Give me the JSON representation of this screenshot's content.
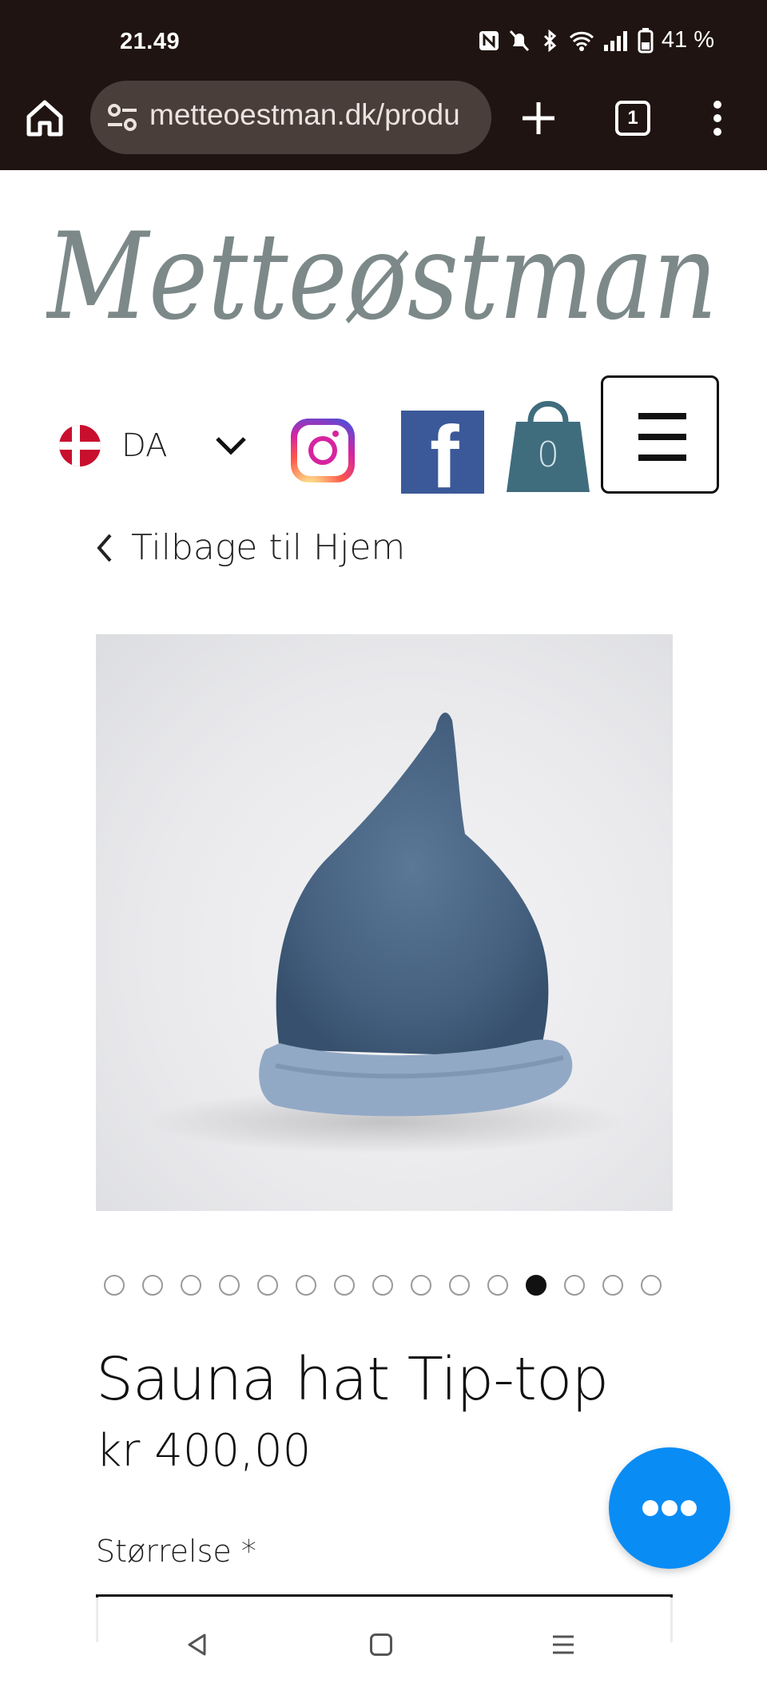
{
  "status_bar": {
    "time": "21.49",
    "battery": "41 %"
  },
  "browser": {
    "url": "metteoestman.dk/produ",
    "tab_count": "1"
  },
  "site": {
    "logo_text": "Metteøstman",
    "language": "DA",
    "cart_count": "0"
  },
  "nav": {
    "back_label": "Tilbage til Hjem"
  },
  "product": {
    "title": "Sauna hat Tip-top",
    "price": "kr 400,00",
    "size_label": "Størrelse *",
    "image_alt": "blue felt pointed sauna hat",
    "carousel_total": 15,
    "carousel_active_index": 11
  },
  "colors": {
    "chrome_bg": "#1f1411",
    "accent_fab": "#0a8cf5",
    "cart_color": "#3f6d7d",
    "logo_color": "#7c8988"
  }
}
